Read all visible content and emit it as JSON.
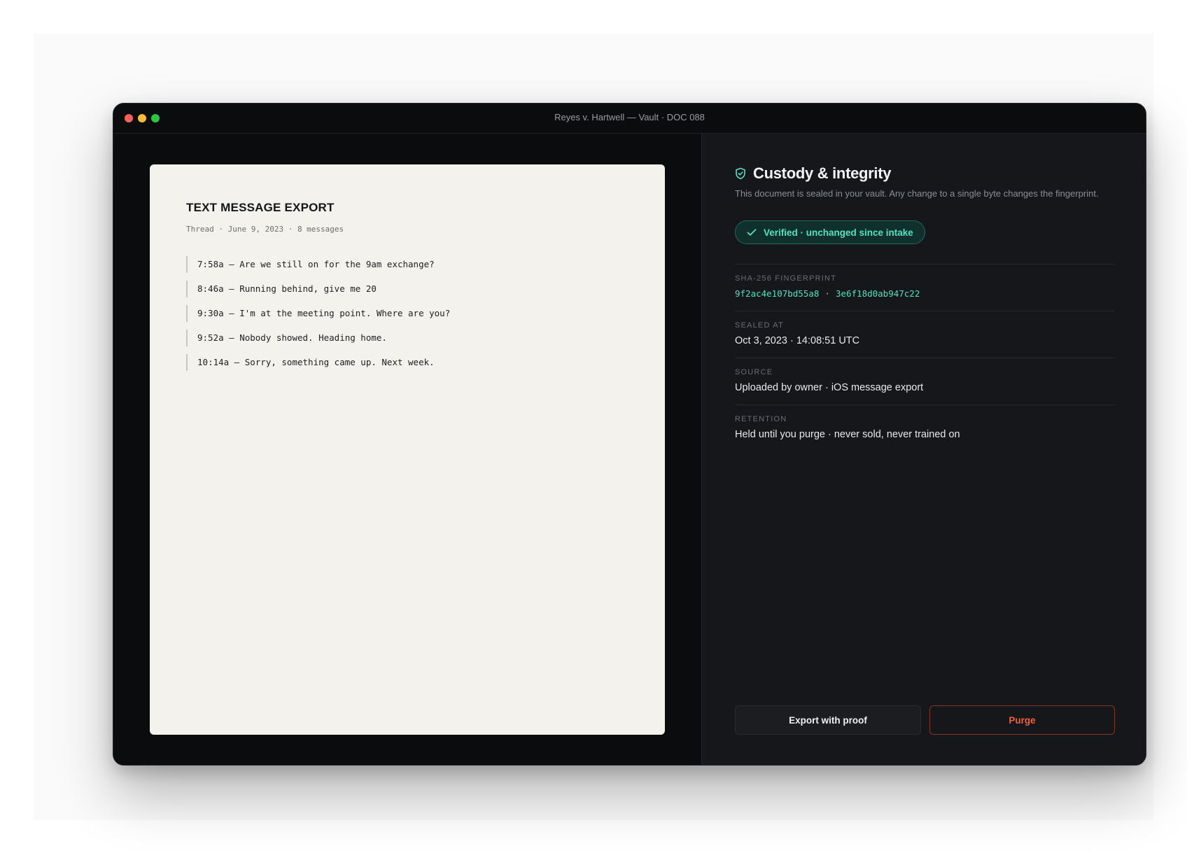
{
  "window": {
    "title": "Reyes v. Hartwell — Vault · DOC 088"
  },
  "document": {
    "title": "TEXT MESSAGE EXPORT",
    "meta": "Thread · June 9, 2023 · 8 messages",
    "messages": [
      "7:58a — Are we still on for the 9am exchange?",
      "8:46a — Running behind, give me 20",
      "9:30a — I'm at the meeting point. Where are you?",
      "9:52a — Nobody showed. Heading home.",
      "10:14a — Sorry, something came up. Next week."
    ]
  },
  "panel": {
    "title": "Custody & integrity",
    "description": "This document is sealed in your vault. Any change to a single byte changes the fingerprint.",
    "badge": "Verified · unchanged since intake",
    "fingerprint": {
      "label": "SHA-256 FINGERPRINT",
      "part1": "9f2ac4e107bd55a8",
      "separator": "·",
      "part2": "3e6f18d0ab947c22"
    },
    "sealed": {
      "label": "SEALED AT",
      "value": "Oct 3, 2023 · 14:08:51 UTC"
    },
    "source": {
      "label": "SOURCE",
      "value": "Uploaded by owner · iOS message export"
    },
    "retention": {
      "label": "RETENTION",
      "value": "Held until you purge · never sold, never trained on"
    }
  },
  "actions": {
    "export_label": "Export with proof",
    "purge_label": "Purge"
  },
  "colors": {
    "accent": "#4fe3c0",
    "danger": "#f0623f",
    "paper": "#f4f2ec"
  },
  "icons": {
    "heading": "shield-check-icon",
    "badge": "check-icon"
  }
}
